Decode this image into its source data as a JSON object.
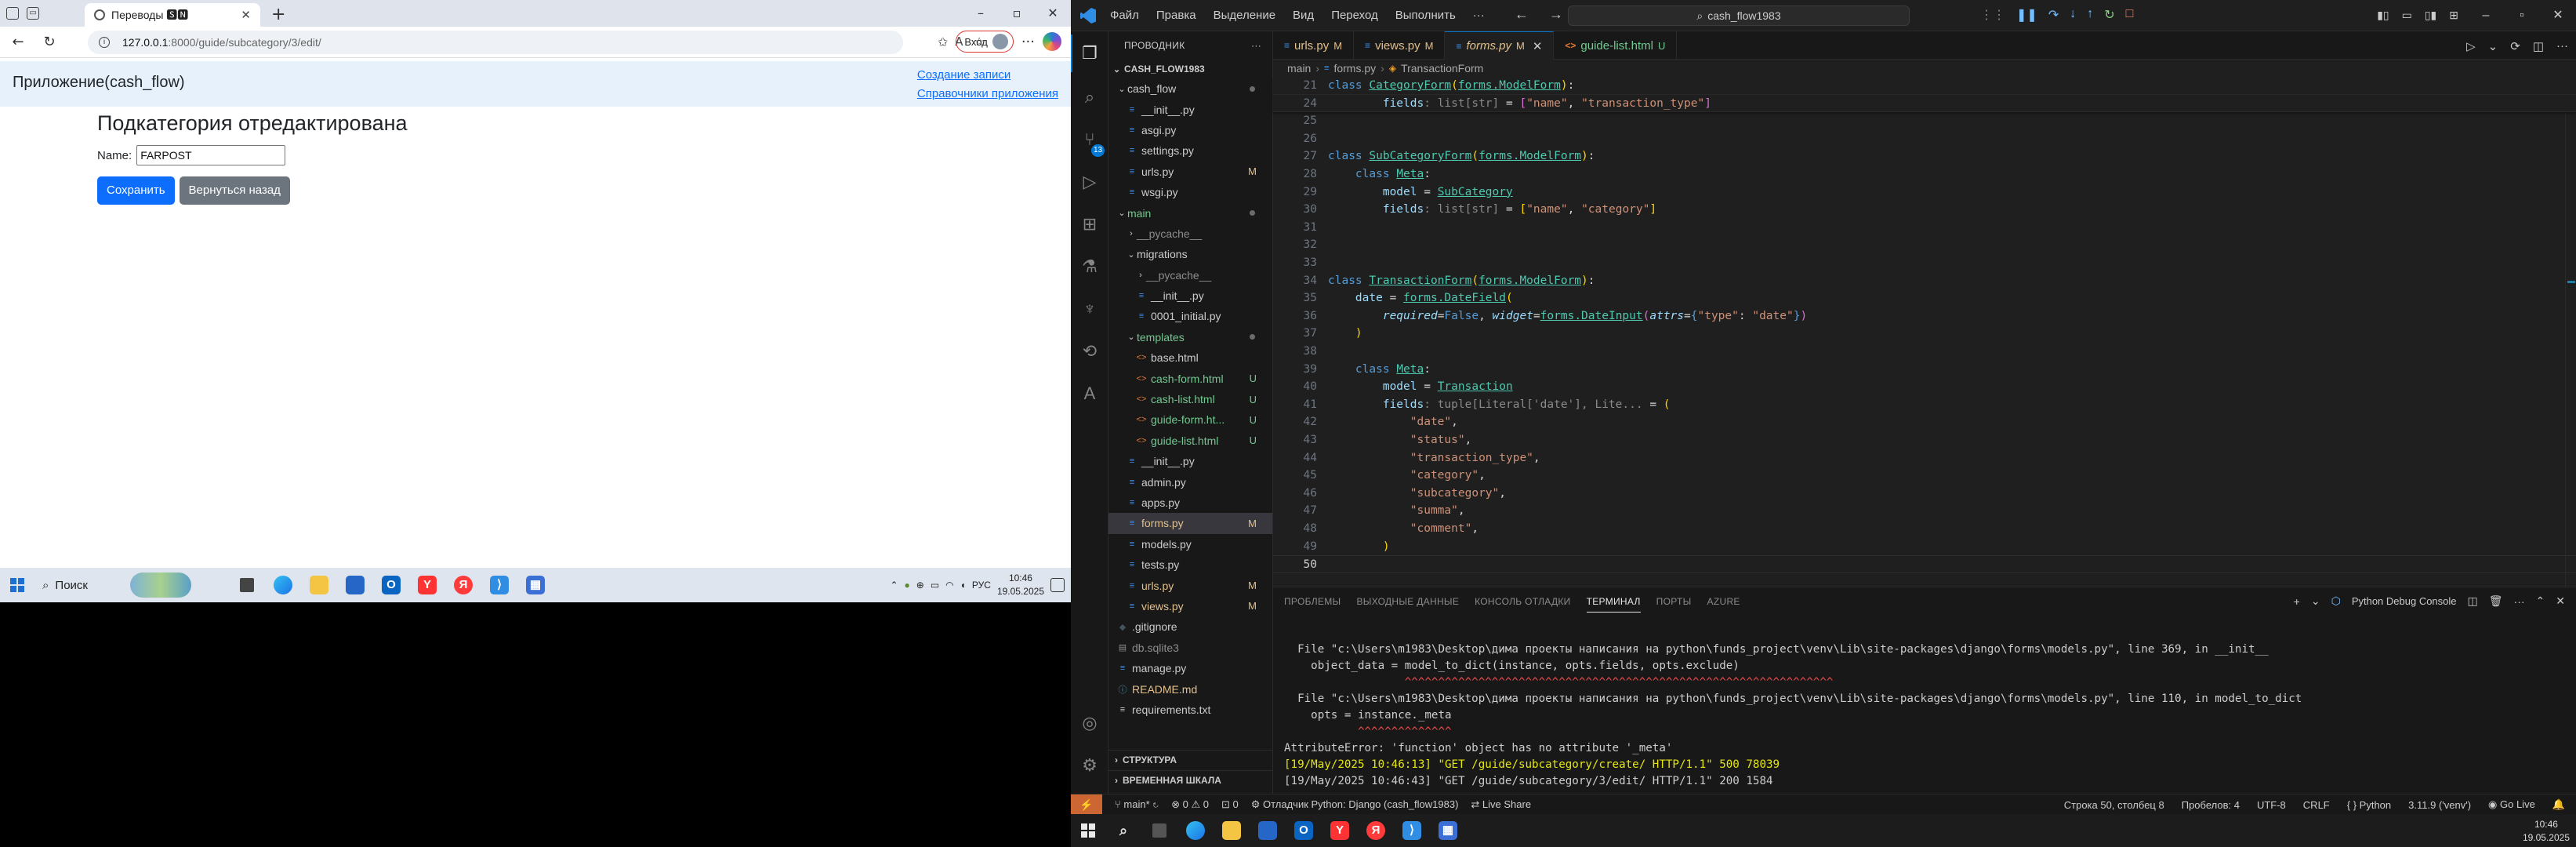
{
  "browser": {
    "tab_title": "Переводы 🆂🅽",
    "url_host": "127.0.0.1",
    "url_path": ":8000/guide/subcategory/3/edit/",
    "login_label": "Вход",
    "page": {
      "brand": "Приложение(cash_flow)",
      "links": [
        "Создание записи",
        "Справочники приложения"
      ],
      "heading": "Подкатегория отредактирована",
      "name_label": "Name:",
      "name_value": "FARPOST",
      "save_button": "Сохранить",
      "back_button": "Вернуться назад"
    },
    "taskbar": {
      "search_label": "Поиск",
      "lang": "РУС",
      "time": "10:46",
      "date": "19.05.2025"
    }
  },
  "vscode": {
    "menu": [
      "Файл",
      "Правка",
      "Выделение",
      "Вид",
      "Переход",
      "Выполнить",
      "···"
    ],
    "command_center": "cash_flow1983",
    "explorer_title": "ПРОВОДНИК",
    "root_folder": "CASH_FLOW1983",
    "tree": [
      {
        "label": "cash_flow",
        "indent": 0,
        "chev": "⌄",
        "kind": "folder",
        "dot": true
      },
      {
        "label": "__init__.py",
        "indent": 1,
        "kind": "py"
      },
      {
        "label": "asgi.py",
        "indent": 1,
        "kind": "py"
      },
      {
        "label": "settings.py",
        "indent": 1,
        "kind": "py"
      },
      {
        "label": "urls.py",
        "indent": 1,
        "kind": "py",
        "badge": "M"
      },
      {
        "label": "wsgi.py",
        "indent": 1,
        "kind": "py"
      },
      {
        "label": "main",
        "indent": 0,
        "chev": "⌄",
        "kind": "folder",
        "dot": true,
        "color": "untr"
      },
      {
        "label": "__pycache__",
        "indent": 1,
        "chev": "›",
        "kind": "folder",
        "color": "dim"
      },
      {
        "label": "migrations",
        "indent": 1,
        "chev": "⌄",
        "kind": "folder"
      },
      {
        "label": "__pycache__",
        "indent": 2,
        "chev": "›",
        "kind": "folder",
        "color": "dim"
      },
      {
        "label": "__init__.py",
        "indent": 2,
        "kind": "py"
      },
      {
        "label": "0001_initial.py",
        "indent": 2,
        "kind": "py"
      },
      {
        "label": "templates",
        "indent": 1,
        "chev": "⌄",
        "kind": "folder",
        "dot": true,
        "color": "untr"
      },
      {
        "label": "base.html",
        "indent": 2,
        "kind": "html"
      },
      {
        "label": "cash-form.html",
        "indent": 2,
        "kind": "html",
        "badge": "U",
        "color": "untr"
      },
      {
        "label": "cash-list.html",
        "indent": 2,
        "kind": "html",
        "badge": "U",
        "color": "untr"
      },
      {
        "label": "guide-form.ht...",
        "indent": 2,
        "kind": "html",
        "badge": "U",
        "color": "untr"
      },
      {
        "label": "guide-list.html",
        "indent": 2,
        "kind": "html",
        "badge": "U",
        "color": "untr"
      },
      {
        "label": "__init__.py",
        "indent": 1,
        "kind": "py"
      },
      {
        "label": "admin.py",
        "indent": 1,
        "kind": "py"
      },
      {
        "label": "apps.py",
        "indent": 1,
        "kind": "py"
      },
      {
        "label": "forms.py",
        "indent": 1,
        "kind": "py",
        "badge": "M",
        "selected": true,
        "color": "mod"
      },
      {
        "label": "models.py",
        "indent": 1,
        "kind": "py"
      },
      {
        "label": "tests.py",
        "indent": 1,
        "kind": "py"
      },
      {
        "label": "urls.py",
        "indent": 1,
        "kind": "py",
        "badge": "M",
        "color": "mod"
      },
      {
        "label": "views.py",
        "indent": 1,
        "kind": "py",
        "badge": "M",
        "color": "mod"
      },
      {
        "label": ".gitignore",
        "indent": 0,
        "kind": "git"
      },
      {
        "label": "db.sqlite3",
        "indent": 0,
        "kind": "db",
        "color": "dim"
      },
      {
        "label": "manage.py",
        "indent": 0,
        "kind": "py"
      },
      {
        "label": "README.md",
        "indent": 0,
        "kind": "md",
        "color": "mod"
      },
      {
        "label": "requirements.txt",
        "indent": 0,
        "kind": "txt"
      }
    ],
    "outline_label": "СТРУКТУРА",
    "timeline_label": "ВРЕМЕННАЯ ШКАЛА",
    "tabs": [
      {
        "label": "urls.py",
        "status": "M",
        "kind": "py"
      },
      {
        "label": "views.py",
        "status": "M",
        "kind": "py"
      },
      {
        "label": "forms.py",
        "status": "M",
        "kind": "py",
        "active": true
      },
      {
        "label": "guide-list.html",
        "status": "U",
        "kind": "html"
      }
    ],
    "breadcrumb": [
      "main",
      "forms.py",
      "TransactionForm"
    ],
    "panel_tabs": [
      "ПРОБЛЕМЫ",
      "ВЫХОДНЫЕ ДАННЫЕ",
      "КОНСОЛЬ ОТЛАДКИ",
      "ТЕРМИНАЛ",
      "ПОРТЫ",
      "AZURE"
    ],
    "panel_active": "ТЕРМИНАЛ",
    "panel_profile": "Python Debug Console",
    "terminal": [
      "  File \"c:\\Users\\m1983\\Desktop\\дима проекты написания на python\\funds_project\\venv\\Lib\\site-packages\\django\\forms\\models.py\", line 369, in __init__",
      "    object_data = model_to_dict(instance, opts.fields, opts.exclude)",
      "                  ^^^^^^^^^^^^^^^^^^^^^^^^^^^^^^^^^^^^^^^^^^^^^^^^^^^^^^^^^^^^^^^^",
      "",
      "  File \"c:\\Users\\m1983\\Desktop\\дима проекты написания на python\\funds_project\\venv\\Lib\\site-packages\\django\\forms\\models.py\", line 110, in model_to_dict",
      "    opts = instance._meta",
      "           ^^^^^^^^^^^^^^",
      "",
      "AttributeError: 'function' object has no attribute '_meta'",
      "[19/May/2025 10:46:13] \"GET /guide/subcategory/create/ HTTP/1.1\" 500 78039",
      "[19/May/2025 10:46:43] \"GET /guide/subcategory/3/edit/ HTTP/1.1\" 200 1584"
    ],
    "status": {
      "branch": "main*",
      "errors": "0",
      "warnings": "0",
      "ports": "0",
      "debugger": "Отладчик Python: Django (cash_flow1983)",
      "live_share": "Live Share",
      "position": "Строка 50, столбец 8",
      "spaces": "Пробелов: 4",
      "encoding": "UTF-8",
      "eol": "CRLF",
      "language": "Python",
      "interpreter": "3.11.9 ('venv')",
      "golive": "Go Live"
    },
    "taskbar": {
      "time": "10:46",
      "date": "19.05.2025"
    }
  },
  "colors": {
    "primary": "#0d6efd",
    "secondary": "#6c757d",
    "vscode_bg": "#1f1f1f",
    "vscode_accent": "#0078d4"
  }
}
